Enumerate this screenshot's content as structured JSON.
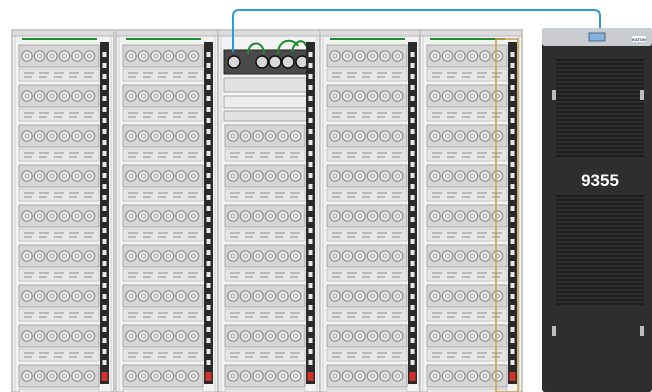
{
  "ups": {
    "model_label": "9355",
    "brand_mark": "EATON"
  },
  "colors": {
    "background": "#ffffff",
    "rack_frame": "#b9b9b9",
    "server_face": "#d6d6d6",
    "fan_ring": "#8f8f8f",
    "pdu_strip": "#2a2a2a",
    "pdu_outlet": "#e8e8e8",
    "power_cord": "#1f8a2e",
    "network_cable": "#2e9bd6",
    "highlight_frame": "#c8a04a",
    "breaker_red": "#d0322b",
    "ups_body": "#2e2e2e",
    "ups_panel_blue": "#7fb3e6"
  },
  "racks": [
    {
      "id": "rack-1",
      "kind": "server",
      "highlighted": false
    },
    {
      "id": "rack-2",
      "kind": "server",
      "highlighted": false
    },
    {
      "id": "rack-3",
      "kind": "switch",
      "highlighted": false
    },
    {
      "id": "rack-4",
      "kind": "server",
      "highlighted": false
    },
    {
      "id": "rack-5",
      "kind": "server",
      "highlighted": true
    }
  ]
}
